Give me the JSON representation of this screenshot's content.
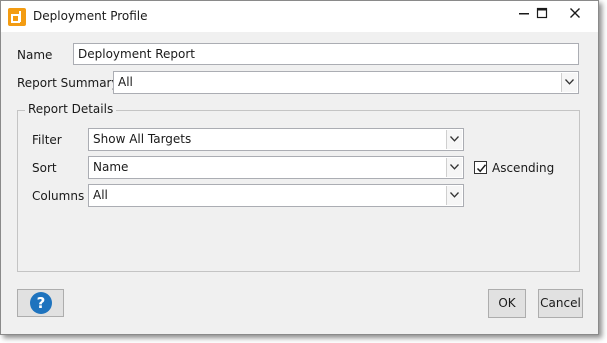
{
  "window": {
    "title": "Deployment Profile"
  },
  "form": {
    "name_label": "Name",
    "name_value": "Deployment Report",
    "report_summary_label": "Report Summary",
    "report_summary_value": "All"
  },
  "report_details": {
    "legend": "Report Details",
    "filter_label": "Filter",
    "filter_value": "Show All Targets",
    "sort_label": "Sort",
    "sort_value": "Name",
    "ascending_label": "Ascending",
    "ascending_checked": true,
    "columns_label": "Columns",
    "columns_value": "All"
  },
  "footer": {
    "help_symbol": "?",
    "ok_label": "OK",
    "cancel_label": "Cancel"
  },
  "colors": {
    "app_icon_orange": "#f39c12",
    "help_blue": "#1e73be"
  },
  "icons": {
    "app": "deployment-profile-app-icon",
    "minimize": "minimize-icon",
    "maximize": "maximize-icon",
    "close": "close-icon",
    "dropdown": "chevron-down-icon",
    "check": "checkmark-icon",
    "help": "help-icon"
  }
}
